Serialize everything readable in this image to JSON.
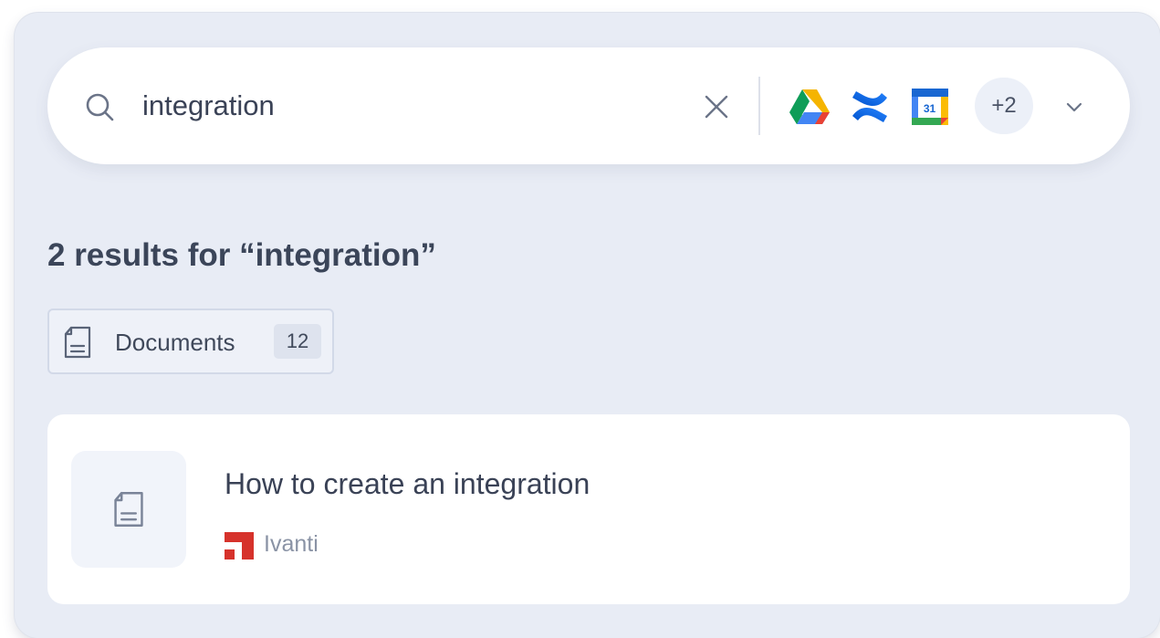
{
  "search": {
    "query": "integration"
  },
  "sources": {
    "icons": [
      "google-drive-icon",
      "confluence-icon",
      "google-calendar-icon"
    ],
    "calendar_day": "31",
    "more_label": "+2"
  },
  "results": {
    "heading": "2 results for “integration”"
  },
  "filters": [
    {
      "label": "Documents",
      "count": "12",
      "icon": "document-icon"
    }
  ],
  "items": [
    {
      "title": "How to create an integration",
      "source": "Ivanti",
      "source_color": "#d6322b"
    }
  ],
  "colors": {
    "panel_bg": "#e8ecf5",
    "text_primary": "#3a4256",
    "text_muted": "#8a93a5",
    "ivanti_red": "#d6322b"
  }
}
